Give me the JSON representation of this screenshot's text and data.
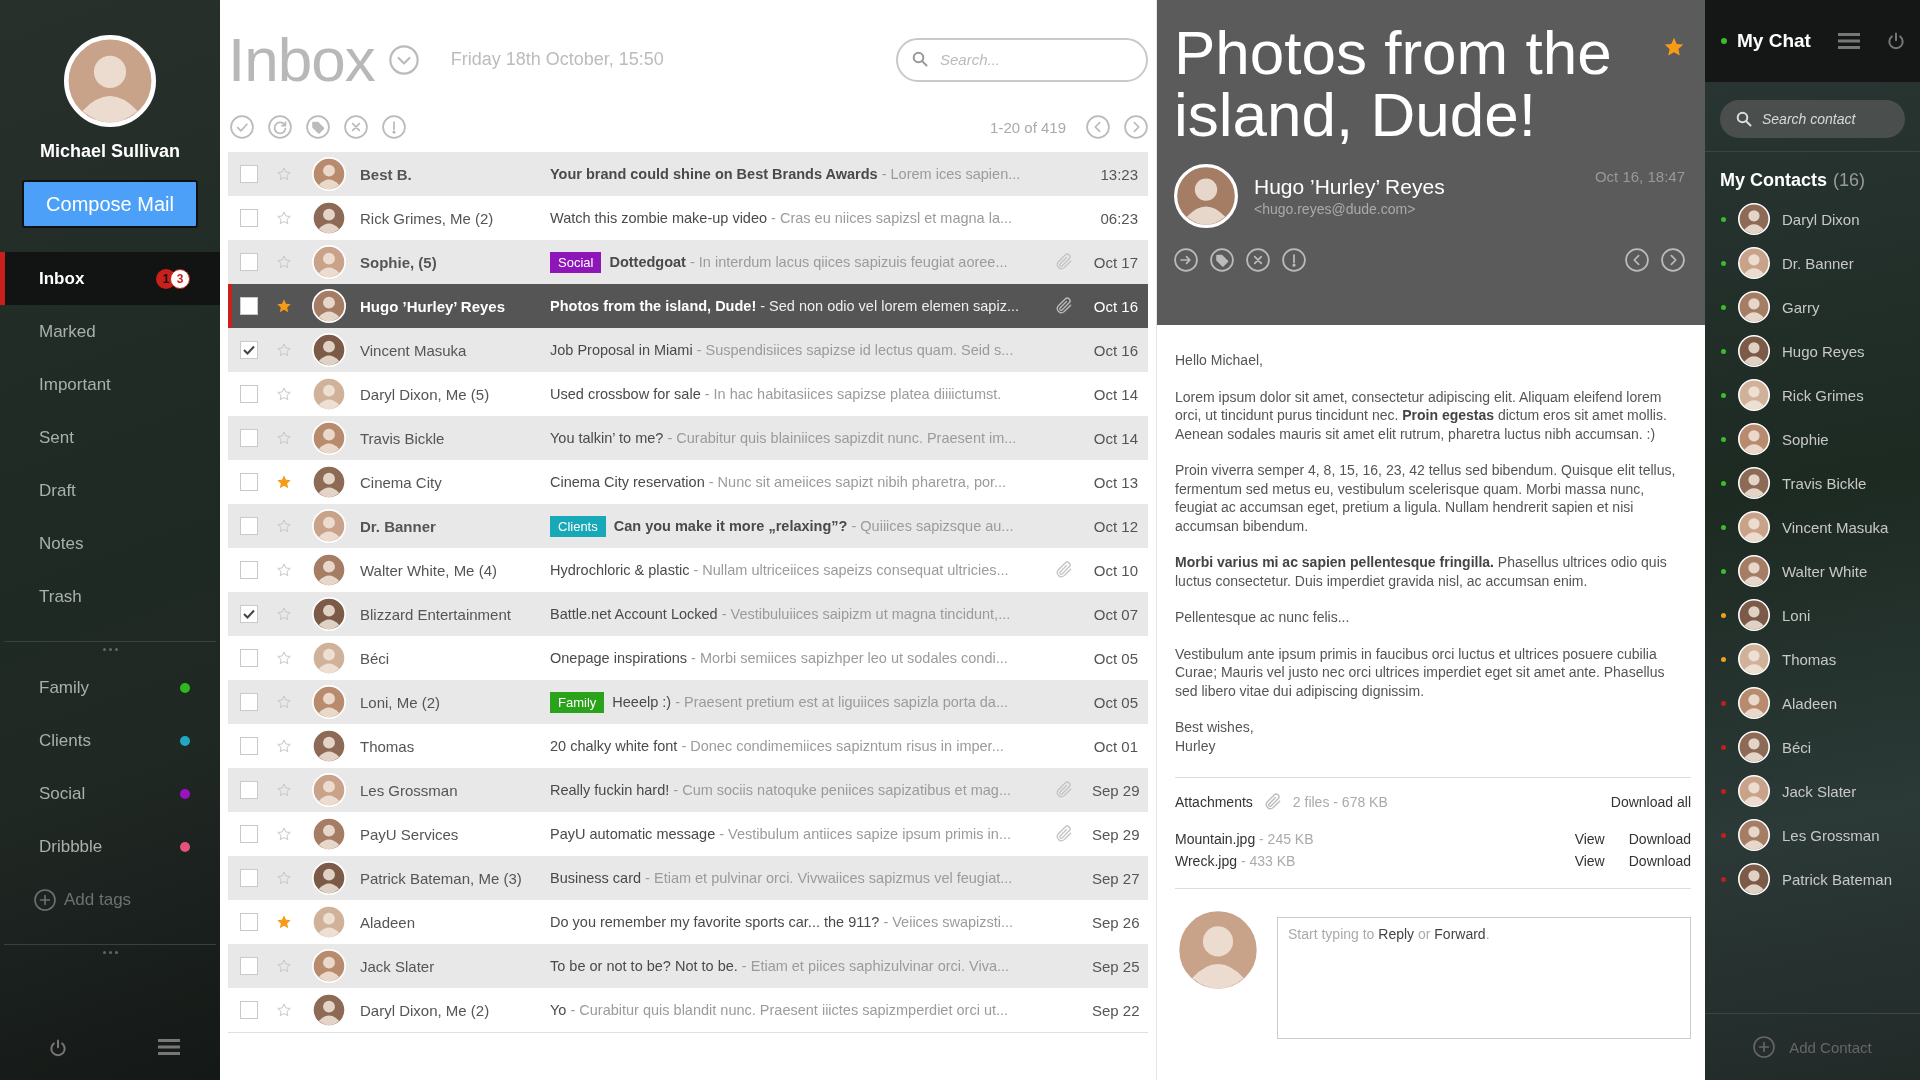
{
  "sidebar": {
    "user_name": "Michael Sullivan",
    "compose_button": "Compose Mail",
    "nav": [
      {
        "label": "Inbox",
        "selected": true,
        "badges": [
          "1",
          "3"
        ]
      },
      {
        "label": "Marked",
        "selected": false
      },
      {
        "label": "Important",
        "selected": false
      },
      {
        "label": "Sent",
        "selected": false
      },
      {
        "label": "Draft",
        "selected": false
      },
      {
        "label": "Notes",
        "selected": false
      },
      {
        "label": "Trash",
        "selected": false
      }
    ],
    "tags": [
      {
        "label": "Family",
        "color": "#2fb81f"
      },
      {
        "label": "Clients",
        "color": "#1fa8c0"
      },
      {
        "label": "Social",
        "color": "#9a12c2"
      },
      {
        "label": "Dribbble",
        "color": "#e5537a"
      }
    ],
    "add_tags": "Add tags"
  },
  "inbox": {
    "title": "Inbox",
    "date": "Friday 18th October, 15:50",
    "search": {
      "placeholder": "Search..."
    },
    "pagination": "1-20 of 419",
    "emails": [
      {
        "sender": "Best B.",
        "subject": "Your brand could shine on Best Brands Awards",
        "preview": "- Lorem ices sapien...",
        "date": "13:23",
        "checked": false,
        "starred": false,
        "unread": true,
        "selected": false,
        "attachment": false
      },
      {
        "sender": "Rick Grimes, Me (2)",
        "subject": "Watch this zombie make-up video",
        "preview": "- Cras eu niices sapizsl et magna la...",
        "date": "06:23",
        "checked": false,
        "starred": false,
        "unread": false,
        "selected": false,
        "attachment": false
      },
      {
        "sender": "Sophie, (5)",
        "tag": {
          "label": "Social",
          "color": "#8e16b8"
        },
        "subject": "Dottedgoat",
        "preview": "- In interdum lacus qiices sapizuis feugiat aoree...",
        "date": "Oct 17",
        "checked": false,
        "starred": false,
        "unread": true,
        "selected": false,
        "attachment": true
      },
      {
        "sender": "Hugo ’Hurley’ Reyes",
        "subject": "Photos from the island, Dude!",
        "preview": "- Sed non odio vel lorem elemen sapiz...",
        "date": "Oct 16",
        "checked": false,
        "starred": true,
        "unread": true,
        "selected": true,
        "attachment": true
      },
      {
        "sender": "Vincent Masuka",
        "subject": "Job Proposal in Miami",
        "preview": "- Suspendisiices sapizse id lectus quam. Seid s...",
        "date": "Oct 16",
        "checked": true,
        "starred": false,
        "unread": false,
        "selected": false,
        "attachment": false
      },
      {
        "sender": "Daryl Dixon, Me (5)",
        "subject": "Used crossbow for sale",
        "preview": "- In hac habitasiices sapizse platea diiiictumst.",
        "date": "Oct 14",
        "checked": false,
        "starred": false,
        "unread": false,
        "selected": false,
        "attachment": false
      },
      {
        "sender": "Travis Bickle",
        "subject": "You talkin’ to me?",
        "preview": "- Curabitur quis blainiices sapizdit nunc. Praesent im...",
        "date": "Oct 14",
        "checked": false,
        "starred": false,
        "unread": false,
        "selected": false,
        "attachment": false
      },
      {
        "sender": "Cinema City",
        "subject": "Cinema City reservation",
        "preview": "- Nunc sit ameiices sapizt nibih pharetra, por...",
        "date": "Oct 13",
        "checked": false,
        "starred": true,
        "unread": false,
        "selected": false,
        "attachment": false
      },
      {
        "sender": "Dr. Banner",
        "tag": {
          "label": "Clients",
          "color": "#17a9b8"
        },
        "subject": "Can you make it more „relaxing”?",
        "preview": "- Quiiices sapizsque au...",
        "date": "Oct 12",
        "checked": false,
        "starred": false,
        "unread": true,
        "selected": false,
        "attachment": false
      },
      {
        "sender": "Walter White, Me (4)",
        "subject": "Hydrochloric & plastic",
        "preview": "- Nullam ultriceiices sapeizs consequat ultricies...",
        "date": "Oct 10",
        "checked": false,
        "starred": false,
        "unread": false,
        "selected": false,
        "attachment": true
      },
      {
        "sender": "Blizzard Entertainment",
        "subject": "Battle.net Account Locked",
        "preview": "- Vestibuluiices saipizm ut magna tincidunt,...",
        "date": "Oct 07",
        "checked": true,
        "starred": false,
        "unread": false,
        "selected": false,
        "attachment": false
      },
      {
        "sender": "Béci",
        "subject": "Onepage inspirations",
        "preview": "- Morbi semiices sapizhper leo ut sodales condi...",
        "date": "Oct 05",
        "checked": false,
        "starred": false,
        "unread": false,
        "selected": false,
        "attachment": false
      },
      {
        "sender": "Loni, Me (2)",
        "tag": {
          "label": "Family",
          "color": "#2aa31a"
        },
        "subject": "Heeelp :)",
        "preview": "- Praesent pretium est at liguiices sapizla porta da...",
        "date": "Oct 05",
        "checked": false,
        "starred": false,
        "unread": false,
        "selected": false,
        "attachment": false
      },
      {
        "sender": "Thomas",
        "subject": "20 chalky white font",
        "preview": "- Donec condimemiices sapizntum risus in imper...",
        "date": "Oct 01",
        "checked": false,
        "starred": false,
        "unread": false,
        "selected": false,
        "attachment": false
      },
      {
        "sender": "Les Grossman",
        "subject": "Really fuckin hard!",
        "preview": "- Cum sociis natoquke peniices sapizatibus et mag...",
        "date": "Sep 29",
        "checked": false,
        "starred": false,
        "unread": false,
        "selected": false,
        "attachment": true
      },
      {
        "sender": "PayU Services",
        "subject": "PayU automatic message",
        "preview": "- Vestibulum antiices sapize ipsum primis in...",
        "date": "Sep 29",
        "checked": false,
        "starred": false,
        "unread": false,
        "selected": false,
        "attachment": true
      },
      {
        "sender": "Patrick Bateman, Me (3)",
        "subject": "Business card",
        "preview": "- Etiam et pulvinar orci. Vivwaiices sapizmus vel feugiat...",
        "date": "Sep 27",
        "checked": false,
        "starred": false,
        "unread": false,
        "selected": false,
        "attachment": false
      },
      {
        "sender": "Aladeen",
        "subject": "Do you remember my favorite sports car... the 911?",
        "preview": "- Veiices swapizsti...",
        "date": "Sep 26",
        "checked": false,
        "starred": true,
        "unread": false,
        "selected": false,
        "attachment": false
      },
      {
        "sender": "Jack Slater",
        "subject": "To be or not to be? Not to be.",
        "preview": "- Etiam et piices saphizulvinar orci. Viva...",
        "date": "Sep 25",
        "checked": false,
        "starred": false,
        "unread": false,
        "selected": false,
        "attachment": false
      },
      {
        "sender": "Daryl Dixon, Me (2)",
        "subject": "Yo",
        "preview": "- Curabitur quis blandit nunc. Praesent iiictes sapizmperdiet orci ut...",
        "date": "Sep 22",
        "checked": false,
        "starred": false,
        "unread": false,
        "selected": false,
        "attachment": false
      }
    ]
  },
  "reader": {
    "title": "Photos from the island, Dude!",
    "starred": true,
    "sender": "Hugo ’Hurley’ Reyes",
    "email": "<hugo.reyes@dude.com>",
    "date": "Oct 16, 18:47",
    "paragraphs": [
      "Hello Michael,",
      "Lorem ipsum dolor sit amet, consectetur adipiscing elit. Aliquam eleifend lorem orci, ut tincidunt purus tincidunt nec. **Proin egestas** dictum eros sit amet mollis. Aenean sodales mauris sit amet elit rutrum, pharetra luctus nibh accumsan. :)",
      "Proin viverra semper 4, 8, 15, 16, 23, 42 tellus sed bibendum. Quisque elit tellus, fermentum sed metus eu, vestibulum scelerisque quam. Morbi massa nunc, feugiat ac accumsan eget, pretium a ligula. Nullam hendrerit sapien et nisi accumsan bibendum.",
      "**Morbi varius mi ac sapien pellentesque fringilla.** Phasellus ultrices odio quis luctus consectetur. Duis imperdiet gravida nisl, ac accumsan enim.",
      "Pellentesque ac nunc felis...",
      "Vestibulum ante ipsum primis in faucibus orci luctus et ultrices posuere cubilia Curae; Mauris vel justo nec orci ultrices imperdiet eget sit amet ante. Phasellus sed libero vitae dui adipiscing dignissim."
    ],
    "signoff": [
      "Best wishes,",
      "Hurley"
    ],
    "attachments": {
      "label": "Attachments",
      "summary": "2 files - 678 KB",
      "download_all": "Download all",
      "files": [
        {
          "name": "Mountain.jpg",
          "size": "- 245 KB",
          "view": "View",
          "download": "Download"
        },
        {
          "name": "Wreck.jpg",
          "size": "- 433 KB",
          "view": "View",
          "download": "Download"
        }
      ]
    },
    "reply": {
      "placeholder": "Start typing to **Reply** or **Forward**."
    }
  },
  "chat": {
    "title": "My Chat",
    "status": {
      "color": "#3dbb2a"
    },
    "search": {
      "placeholder": "Search contact"
    },
    "contacts_heading": "My Contacts",
    "contacts_count": "(16)",
    "contacts": [
      {
        "name": "Daryl Dixon",
        "color": "#3dbb2a"
      },
      {
        "name": "Dr. Banner",
        "color": "#3dbb2a"
      },
      {
        "name": "Garry",
        "color": "#3dbb2a"
      },
      {
        "name": "Hugo Reyes",
        "color": "#3dbb2a"
      },
      {
        "name": "Rick Grimes",
        "color": "#3dbb2a"
      },
      {
        "name": "Sophie",
        "color": "#3dbb2a"
      },
      {
        "name": "Travis Bickle",
        "color": "#3dbb2a"
      },
      {
        "name": "Vincent Masuka",
        "color": "#3dbb2a"
      },
      {
        "name": "Walter White",
        "color": "#3dbb2a"
      },
      {
        "name": "Loni",
        "color": "#f0a020"
      },
      {
        "name": "Thomas",
        "color": "#f0a020"
      },
      {
        "name": "Aladeen",
        "color": "#c0201c"
      },
      {
        "name": "Béci",
        "color": "#c0201c"
      },
      {
        "name": "Jack Slater",
        "color": "#c0201c"
      },
      {
        "name": "Les Grossman",
        "color": "#c0201c"
      },
      {
        "name": "Patrick Bateman",
        "color": "#c0201c"
      }
    ],
    "add_contact": "Add Contact"
  }
}
